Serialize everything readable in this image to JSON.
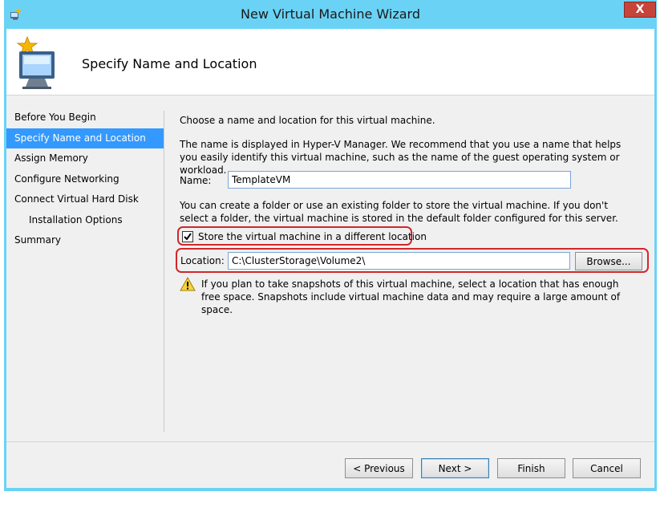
{
  "window": {
    "title": "New Virtual Machine Wizard",
    "close_label": "X"
  },
  "header": {
    "title": "Specify Name and Location"
  },
  "nav": {
    "items": [
      {
        "label": "Before You Begin"
      },
      {
        "label": "Specify Name and Location"
      },
      {
        "label": "Assign Memory"
      },
      {
        "label": "Configure Networking"
      },
      {
        "label": "Connect Virtual Hard Disk"
      },
      {
        "label": "Installation Options"
      },
      {
        "label": "Summary"
      }
    ]
  },
  "content": {
    "intro": "Choose a name and location for this virtual machine.",
    "name_help": "The name is displayed in Hyper-V Manager. We recommend that you use a name that helps you easily identify this virtual machine, such as the name of the guest operating system or workload.",
    "name_label": "Name:",
    "name_value": "TemplateVM",
    "folder_help": "You can create a folder or use an existing folder to store the virtual machine. If you don't select a folder, the virtual machine is stored in the default folder configured for this server.",
    "store_checkbox_label": "Store the virtual machine in a different location",
    "store_checked": true,
    "location_label": "Location:",
    "location_value": "C:\\ClusterStorage\\Volume2\\",
    "browse_label": "Browse...",
    "warning_text": "If you plan to take snapshots of this virtual machine, select a location that has enough free space. Snapshots include virtual machine data and may require a large amount of space."
  },
  "footer": {
    "previous_label": "< Previous",
    "next_label": "Next >",
    "finish_label": "Finish",
    "cancel_label": "Cancel"
  },
  "colors": {
    "titlebar": "#6ad3f5",
    "selection": "#3399ff",
    "annotation": "#d0282b",
    "close": "#c7443b"
  }
}
